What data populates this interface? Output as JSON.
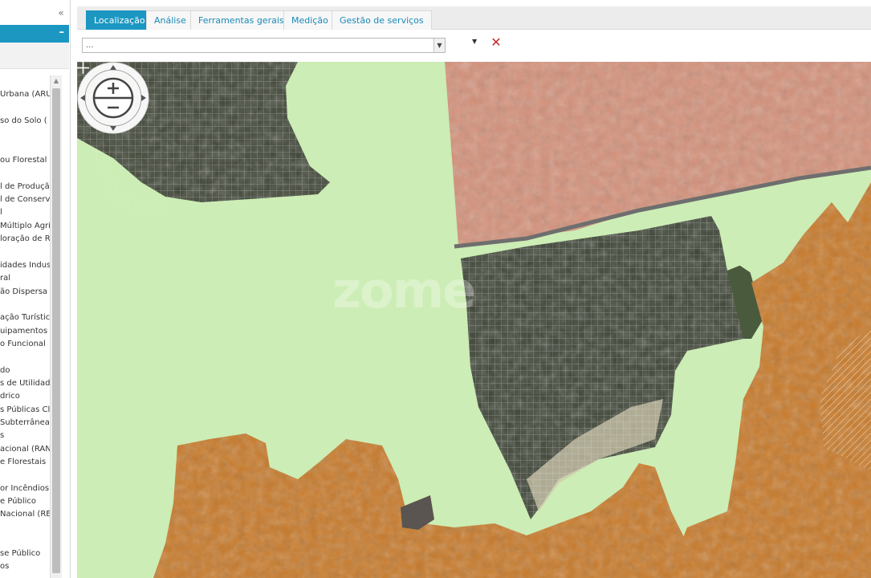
{
  "sidebar": {
    "collapse_icon": "«",
    "header_minus": "–",
    "layers": [
      "Urbana (ARU",
      "so do Solo (",
      "ou Florestal",
      "l de Produçã",
      "l de Conserv",
      "l",
      "Múltiplo Agríc",
      "loração de R",
      "idades Indus",
      "ral",
      "ão Dispersa",
      "ação Turístic",
      "uipamentos e",
      "o Funcional",
      "do",
      "s de Utilidade",
      "drico",
      "s Públicas Cla",
      "Subterrânea",
      "s",
      "acional (RAN",
      "e Florestais",
      "or Incêndios",
      "e Público",
      "Nacional (REN",
      "se Público",
      "os"
    ]
  },
  "tabs": [
    {
      "label": "Localização",
      "active": true
    },
    {
      "label": "Análise",
      "active": false
    },
    {
      "label": "Ferramentas gerais",
      "active": false
    },
    {
      "label": "Medição",
      "active": false
    },
    {
      "label": "Gestão de serviços",
      "active": false
    }
  ],
  "toolbar": {
    "select_value": "...",
    "select_arrow": "▼",
    "small_caret": "▼",
    "clear_symbol": "✕"
  },
  "map": {
    "watermark": "zome",
    "colors": {
      "green_zone": "#ccedb5",
      "salmon_zone": "#d4917a",
      "orange_zone": "#c87a2a",
      "aerial_dark": "#3e4436",
      "accent": "#1b97c2",
      "clear_red": "#c42a2a"
    }
  }
}
